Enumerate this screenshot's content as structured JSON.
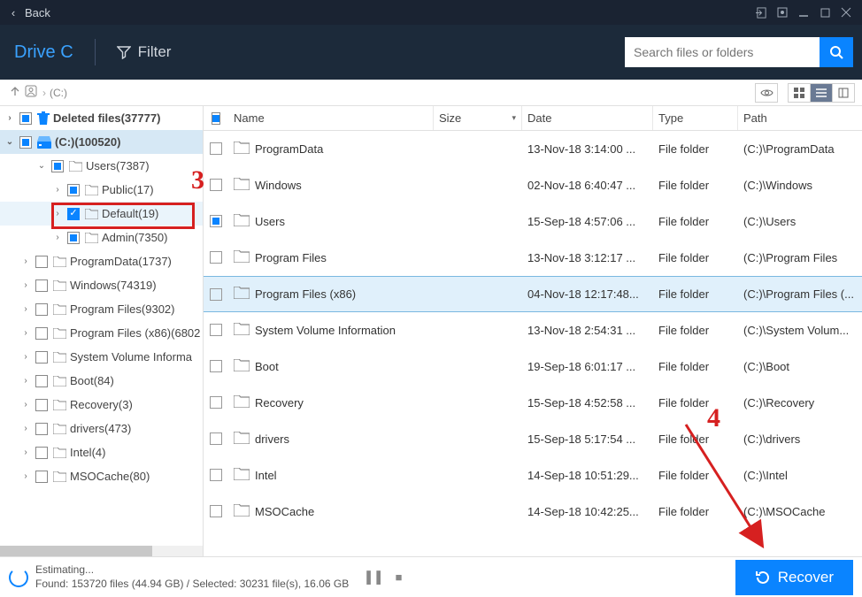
{
  "titlebar": {
    "back_label": "Back"
  },
  "header": {
    "drive_label": "Drive C",
    "filter_label": "Filter",
    "search_placeholder": "Search files or folders"
  },
  "breadcrumb": {
    "path": "(C:)"
  },
  "tree": {
    "deleted_label": "Deleted files(37777)",
    "drive_label": "(C:)(100520)",
    "items": [
      {
        "label": "Users(7387)",
        "indent": 2,
        "check": "partial",
        "expanded": true
      },
      {
        "label": "Public(17)",
        "indent": 3,
        "check": "partial",
        "expanded": false
      },
      {
        "label": "Default(19)",
        "indent": 3,
        "check": "checked",
        "expanded": false
      },
      {
        "label": "Admin(7350)",
        "indent": 3,
        "check": "partial",
        "expanded": false
      },
      {
        "label": "ProgramData(1737)",
        "indent": 1,
        "check": "none",
        "expanded": false
      },
      {
        "label": "Windows(74319)",
        "indent": 1,
        "check": "none",
        "expanded": false
      },
      {
        "label": "Program Files(9302)",
        "indent": 1,
        "check": "none",
        "expanded": false
      },
      {
        "label": "Program Files (x86)(6802",
        "indent": 1,
        "check": "none",
        "expanded": false
      },
      {
        "label": "System Volume Informa",
        "indent": 1,
        "check": "none",
        "expanded": false
      },
      {
        "label": "Boot(84)",
        "indent": 1,
        "check": "none",
        "expanded": false
      },
      {
        "label": "Recovery(3)",
        "indent": 1,
        "check": "none",
        "expanded": false
      },
      {
        "label": "drivers(473)",
        "indent": 1,
        "check": "none",
        "expanded": false
      },
      {
        "label": "Intel(4)",
        "indent": 1,
        "check": "none",
        "expanded": false
      },
      {
        "label": "MSOCache(80)",
        "indent": 1,
        "check": "none",
        "expanded": false
      }
    ]
  },
  "list": {
    "columns": {
      "name": "Name",
      "size": "Size",
      "date": "Date",
      "type": "Type",
      "path": "Path"
    },
    "rows": [
      {
        "name": "ProgramData",
        "size": "",
        "date": "13-Nov-18 3:14:00 ...",
        "type": "File folder",
        "path": "(C:)\\ProgramData",
        "check": "none"
      },
      {
        "name": "Windows",
        "size": "",
        "date": "02-Nov-18 6:40:47 ...",
        "type": "File folder",
        "path": "(C:)\\Windows",
        "check": "none"
      },
      {
        "name": "Users",
        "size": "",
        "date": "15-Sep-18 4:57:06 ...",
        "type": "File folder",
        "path": "(C:)\\Users",
        "check": "partial"
      },
      {
        "name": "Program Files",
        "size": "",
        "date": "13-Nov-18 3:12:17 ...",
        "type": "File folder",
        "path": "(C:)\\Program Files",
        "check": "none"
      },
      {
        "name": "Program Files (x86)",
        "size": "",
        "date": "04-Nov-18 12:17:48...",
        "type": "File folder",
        "path": "(C:)\\Program Files (...",
        "check": "none",
        "selected": true
      },
      {
        "name": "System Volume Information",
        "size": "",
        "date": "13-Nov-18 2:54:31 ...",
        "type": "File folder",
        "path": "(C:)\\System Volum...",
        "check": "none"
      },
      {
        "name": "Boot",
        "size": "",
        "date": "19-Sep-18 6:01:17 ...",
        "type": "File folder",
        "path": "(C:)\\Boot",
        "check": "none"
      },
      {
        "name": "Recovery",
        "size": "",
        "date": "15-Sep-18 4:52:58 ...",
        "type": "File folder",
        "path": "(C:)\\Recovery",
        "check": "none"
      },
      {
        "name": "drivers",
        "size": "",
        "date": "15-Sep-18 5:17:54 ...",
        "type": "File folder",
        "path": "(C:)\\drivers",
        "check": "none"
      },
      {
        "name": "Intel",
        "size": "",
        "date": "14-Sep-18 10:51:29...",
        "type": "File folder",
        "path": "(C:)\\Intel",
        "check": "none"
      },
      {
        "name": "MSOCache",
        "size": "",
        "date": "14-Sep-18 10:42:25...",
        "type": "File folder",
        "path": "(C:)\\MSOCache",
        "check": "none"
      }
    ]
  },
  "footer": {
    "status_line1": "Estimating...",
    "status_line2": "Found: 153720 files (44.94 GB) / Selected: 30231 file(s), 16.06 GB",
    "recover_label": "Recover"
  },
  "annotations": {
    "num3": "3",
    "num4": "4"
  }
}
